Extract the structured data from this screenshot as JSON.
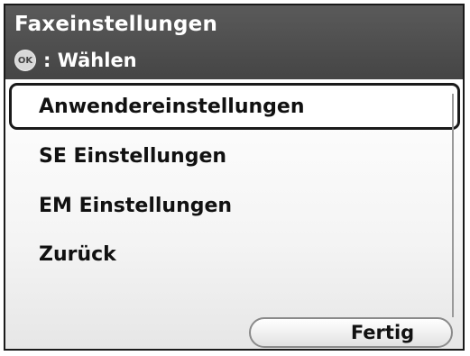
{
  "header": {
    "title": "Faxeinstellungen",
    "ok_icon_label": "OK",
    "hint_text": ": Wählen"
  },
  "menu": {
    "items": [
      {
        "label": "Anwendereinstellungen",
        "selected": true
      },
      {
        "label": "SE Einstellungen",
        "selected": false
      },
      {
        "label": "EM Einstellungen",
        "selected": false
      },
      {
        "label": "Zurück",
        "selected": false
      }
    ]
  },
  "footer": {
    "done_label": "Fertig"
  },
  "colors": {
    "header_bg": "#4f4f4f",
    "header_text": "#ffffff",
    "selection_border": "#1a1a1a"
  }
}
